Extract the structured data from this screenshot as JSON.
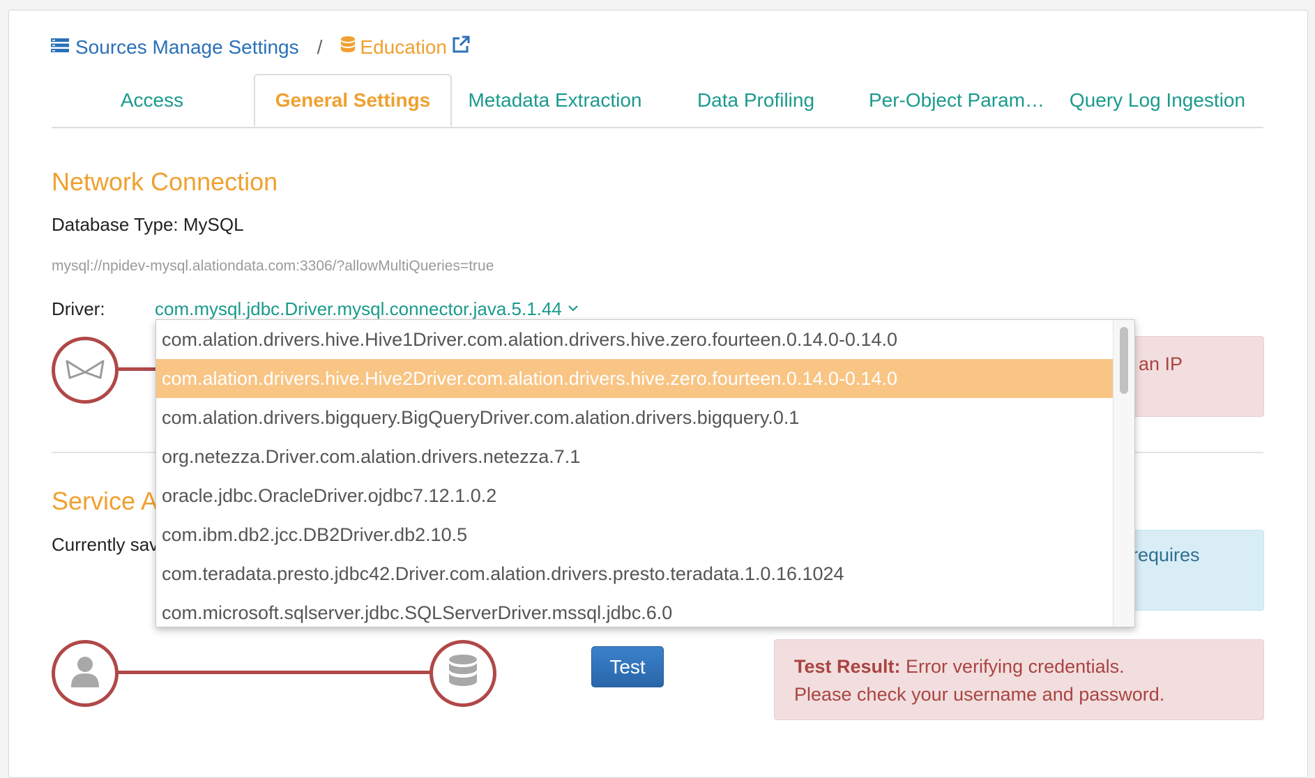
{
  "breadcrumb": {
    "parent_label": "Sources Manage Settings",
    "separator": "/",
    "current_label": "Education"
  },
  "tabs": [
    {
      "label": "Access"
    },
    {
      "label": "General Settings",
      "active": true
    },
    {
      "label": "Metadata Extraction"
    },
    {
      "label": "Data Profiling"
    },
    {
      "label": "Per-Object Param…"
    },
    {
      "label": "Query Log Ingestion"
    }
  ],
  "network": {
    "title": "Network Connection",
    "database_type": "Database Type: MySQL",
    "url": "mysql://npidev-mysql.alationdata.com:3306/?allowMultiQueries=true",
    "driver_label": "Driver:",
    "driver_value": "com.mysql.jdbc.Driver.mysql.connector.java.5.1.44",
    "alert_text_visible": "an IP"
  },
  "service": {
    "title_visible": "Service Ac",
    "currently_saved_visible": "Currently sav",
    "alert_text_visible": "requires",
    "test_button": "Test",
    "result_label": "Test Result:",
    "result_text": "Error verifying credentials. Please check your username and password."
  },
  "driver_options": [
    "com.alation.drivers.hive.Hive1Driver.com.alation.drivers.hive.zero.fourteen.0.14.0-0.14.0",
    "com.alation.drivers.hive.Hive2Driver.com.alation.drivers.hive.zero.fourteen.0.14.0-0.14.0",
    "com.alation.drivers.bigquery.BigQueryDriver.com.alation.drivers.bigquery.0.1",
    "org.netezza.Driver.com.alation.drivers.netezza.7.1",
    "oracle.jdbc.OracleDriver.ojdbc7.12.1.0.2",
    "com.ibm.db2.jcc.DB2Driver.db2.10.5",
    "com.teradata.presto.jdbc42.Driver.com.alation.drivers.presto.teradata.1.0.16.1024",
    "com.microsoft.sqlserver.jdbc.SQLServerDriver.mssql.jdbc.6.0"
  ],
  "selected_option_index": 1,
  "colors": {
    "accent_orange": "#f0a030",
    "teal_link": "#1a9a8c",
    "blue_link": "#2a70b8",
    "error_red": "#b04848",
    "selected_row": "#f8c585"
  },
  "icons": [
    "server-list-icon",
    "database-stack-icon",
    "external-link-icon",
    "chevron-down-icon",
    "network-bowtie-icon",
    "user-icon",
    "database-icon"
  ]
}
